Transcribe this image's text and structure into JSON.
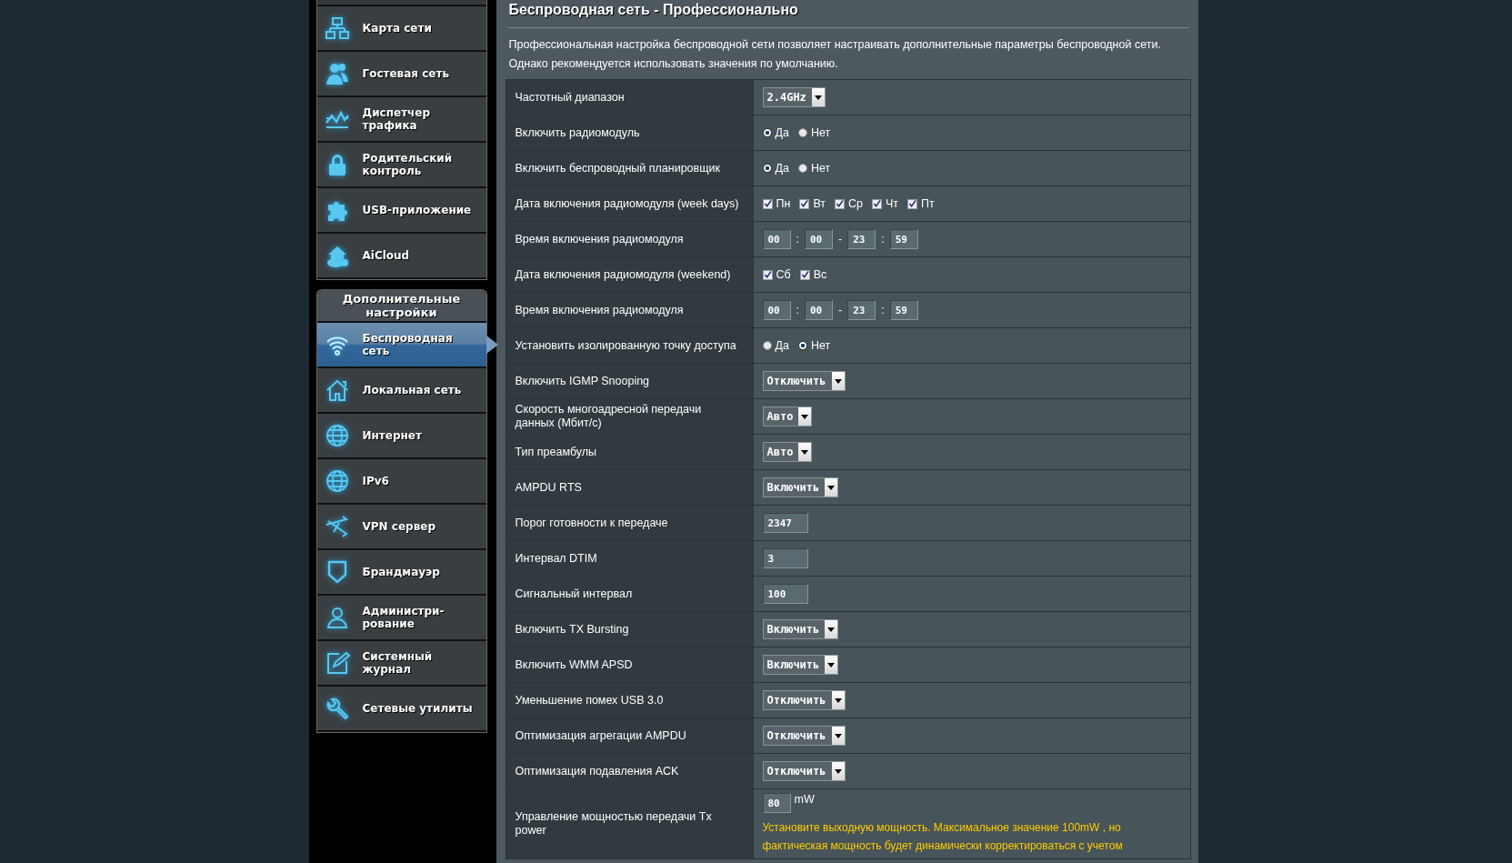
{
  "sidebar": {
    "items": [
      {
        "label": "Карта сети",
        "selected": false
      },
      {
        "label": "Гостевая сеть",
        "selected": false
      },
      {
        "label": "Диспетчер трафика",
        "selected": false
      },
      {
        "label": "Родительский контроль",
        "selected": false
      },
      {
        "label": "USB-приложение",
        "selected": false
      },
      {
        "label": "AiCloud",
        "selected": false
      }
    ],
    "section_title": "Дополнительные настройки",
    "advanced_items": [
      {
        "label": "Беспроводная сеть",
        "selected": true
      },
      {
        "label": "Локальная сеть",
        "selected": false
      },
      {
        "label": "Интернет",
        "selected": false
      },
      {
        "label": "IPv6",
        "selected": false
      },
      {
        "label": "VPN сервер",
        "selected": false
      },
      {
        "label": "Брандмауэр",
        "selected": false
      },
      {
        "label": "Администри-рование",
        "selected": false
      },
      {
        "label": "Системный журнал",
        "selected": false
      },
      {
        "label": "Сетевые утилиты",
        "selected": false
      }
    ]
  },
  "page": {
    "title": "Беспроводная сеть - Профессионально",
    "description": "Профессиональная настройка беспроводной сети позволяет настраивать дополнительные параметры беспроводной сети. Однако рекомендуется использовать значения по умолчанию."
  },
  "settings": [
    {
      "label": "Частотный диапазон",
      "kind": "select",
      "value": "2.4GHz"
    },
    {
      "label": "Включить радиомодуль",
      "kind": "radio",
      "options": [
        {
          "label": "Да",
          "selected": true
        },
        {
          "label": "Нет",
          "selected": false
        }
      ]
    },
    {
      "label": "Включить беспроводный планировщик",
      "kind": "radio",
      "options": [
        {
          "label": "Да",
          "selected": true
        },
        {
          "label": "Нет",
          "selected": false
        }
      ]
    },
    {
      "label": "Дата включения радиомодуля (week days)",
      "kind": "checks",
      "options": [
        {
          "label": "Пн",
          "checked": true
        },
        {
          "label": "Вт",
          "checked": true
        },
        {
          "label": "Ср",
          "checked": true
        },
        {
          "label": "Чт",
          "checked": true
        },
        {
          "label": "Пт",
          "checked": true
        }
      ]
    },
    {
      "label": "Время включения радиомодуля",
      "kind": "time",
      "fields": [
        "00",
        "00",
        "23",
        "59"
      ],
      "separators": [
        ":",
        "-",
        ":"
      ]
    },
    {
      "label": "Дата включения радиомодуля (weekend)",
      "kind": "checks",
      "options": [
        {
          "label": "Сб",
          "checked": true
        },
        {
          "label": "Вс",
          "checked": true
        }
      ]
    },
    {
      "label": "Время включения радиомодуля",
      "kind": "time",
      "fields": [
        "00",
        "00",
        "23",
        "59"
      ],
      "separators": [
        ":",
        "-",
        ":"
      ]
    },
    {
      "label": "Установить изолированную точку доступа",
      "kind": "radio",
      "options": [
        {
          "label": "Да",
          "selected": false
        },
        {
          "label": "Нет",
          "selected": true
        }
      ]
    },
    {
      "label": "Включить IGMP Snooping",
      "kind": "select",
      "value": "Отключить"
    },
    {
      "label": "Скорость многоадресной передачи данных (Мбит/с)",
      "kind": "select",
      "value": "Авто"
    },
    {
      "label": "Тип преамбулы",
      "kind": "select",
      "value": "Авто"
    },
    {
      "label": "AMPDU RTS",
      "kind": "select",
      "value": "Включить"
    },
    {
      "label": "Порог готовности к передаче",
      "kind": "text",
      "value": "2347"
    },
    {
      "label": "Интервал DTIM",
      "kind": "text",
      "value": "3"
    },
    {
      "label": "Сигнальный интервал",
      "kind": "text",
      "value": "100"
    },
    {
      "label": "Включить TX Bursting",
      "kind": "select",
      "value": "Включить"
    },
    {
      "label": "Включить WMM APSD",
      "kind": "select",
      "value": "Включить"
    },
    {
      "label": "Уменьшение помех USB 3.0",
      "kind": "select",
      "value": "Отключить"
    },
    {
      "label": "Оптимизация агрегации AMPDU",
      "kind": "select",
      "value": "Отключить"
    },
    {
      "label": "Оптимизация подавления ACK",
      "kind": "select",
      "value": "Отключить"
    },
    {
      "label": "Управление мощностью передачи Tx power",
      "kind": "power",
      "value": "80",
      "unit": "mW",
      "note": "Установите выходную мощность. Максимальное значение 100mW , но фактическая мощность будет динамически корректироваться с учетом"
    }
  ]
}
